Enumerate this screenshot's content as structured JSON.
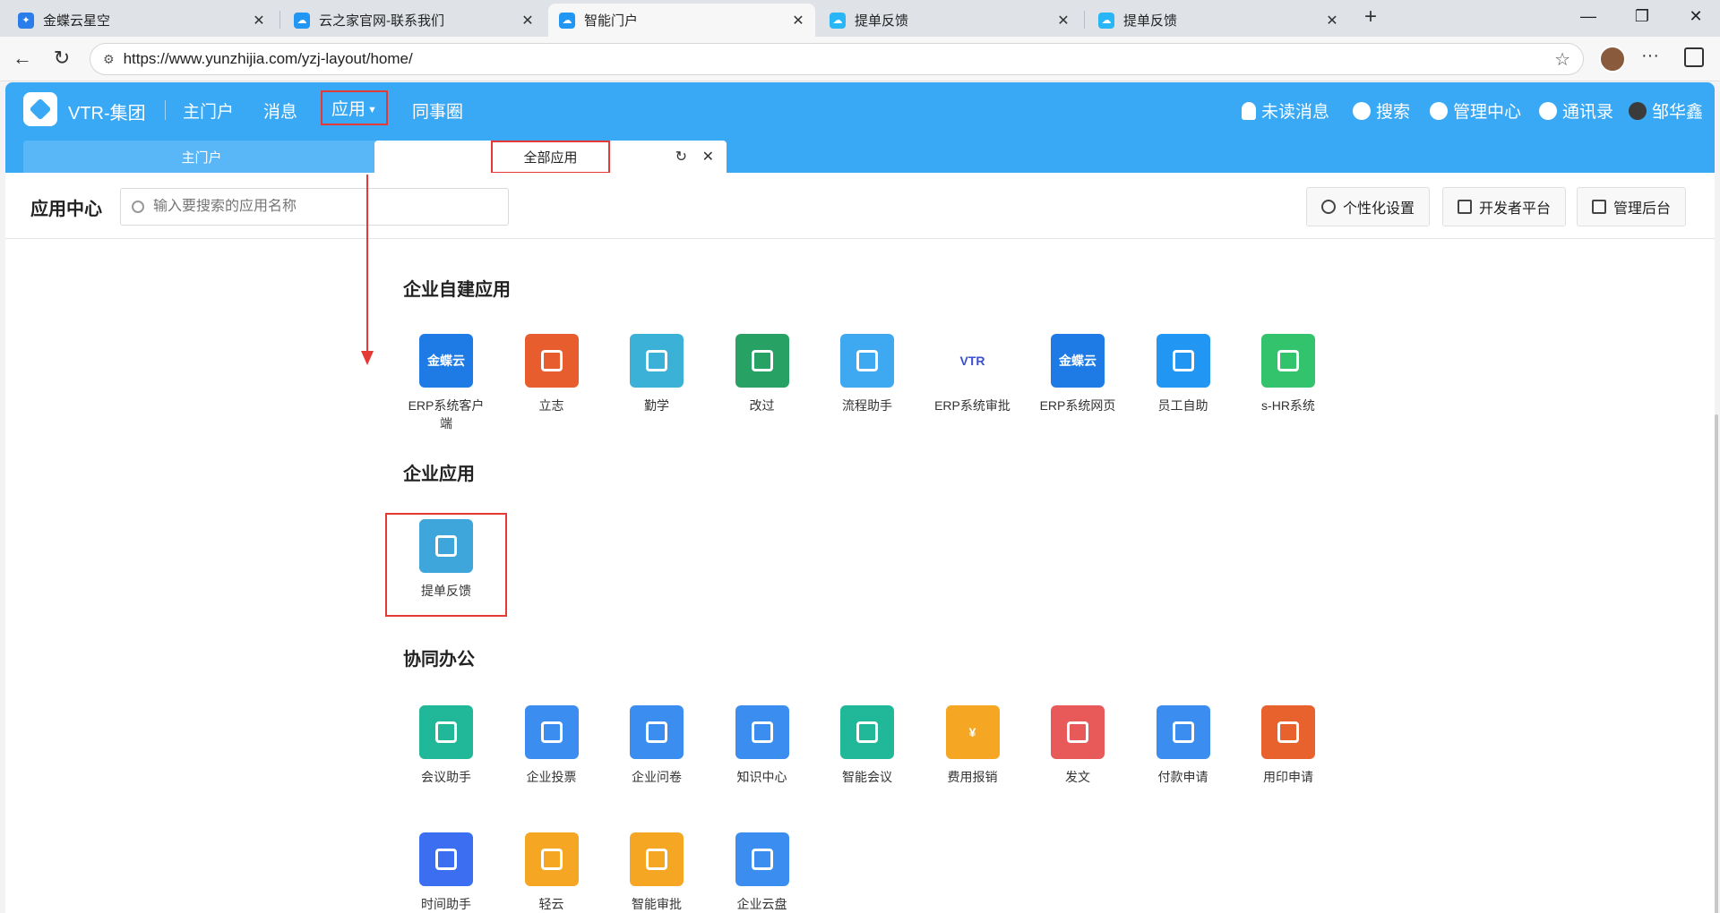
{
  "browser": {
    "tabs": [
      {
        "label": "金蝶云星空",
        "favicon": "kingdee-icon",
        "color": "#2b7de9"
      },
      {
        "label": "云之家官网-联系我们",
        "favicon": "cloud-icon",
        "color": "#2196f3"
      },
      {
        "label": "智能门户",
        "favicon": "cloud-icon",
        "color": "#2196f3"
      },
      {
        "label": "提单反馈",
        "favicon": "cloud-icon",
        "color": "#29b6f6"
      },
      {
        "label": "提单反馈",
        "favicon": "cloud-icon",
        "color": "#29b6f6"
      }
    ],
    "url": "https://www.yunzhijia.com/yzj-layout/home/"
  },
  "header": {
    "brand": "VTR-集团",
    "nav": {
      "home": "主门户",
      "messages": "消息",
      "apps": "应用",
      "colleagues": "同事圈"
    },
    "tools": {
      "unread": "未读消息",
      "search": "搜索",
      "admin": "管理中心",
      "contacts": "通讯录",
      "user": "邹华鑫"
    },
    "subtabs": {
      "home": "主门户",
      "all_apps": "全部应用"
    }
  },
  "toolbar": {
    "title": "应用中心",
    "search_placeholder": "输入要搜索的应用名称",
    "personalize": "个性化设置",
    "developer": "开发者平台",
    "admin_backend": "管理后台"
  },
  "sections": {
    "self_built": {
      "title": "企业自建应用",
      "apps": [
        {
          "label": "ERP系统客户端",
          "icon_text": "金蝶云",
          "color": "#1e7be6"
        },
        {
          "label": "立志",
          "icon_text": "",
          "color": "#e85d2e"
        },
        {
          "label": "勤学",
          "icon_text": "",
          "color": "#3bb1d8"
        },
        {
          "label": "改过",
          "icon_text": "",
          "color": "#27a164"
        },
        {
          "label": "流程助手",
          "icon_text": "",
          "color": "#3ea9f0"
        },
        {
          "label": "ERP系统审批",
          "icon_text": "VTR",
          "color": "#ffffff"
        },
        {
          "label": "ERP系统网页",
          "icon_text": "金蝶云",
          "color": "#1e7be6"
        },
        {
          "label": "员工自助",
          "icon_text": "",
          "color": "#2196f3"
        },
        {
          "label": "s-HR系统",
          "icon_text": "",
          "color": "#32c36c"
        }
      ]
    },
    "enterprise": {
      "title": "企业应用",
      "apps": [
        {
          "label": "提单反馈",
          "icon_text": "",
          "color": "#3fa6dc"
        }
      ]
    },
    "collab": {
      "title": "协同办公",
      "apps": [
        {
          "label": "会议助手",
          "icon_text": "",
          "color": "#21b89a"
        },
        {
          "label": "企业投票",
          "icon_text": "",
          "color": "#3b8ef0"
        },
        {
          "label": "企业问卷",
          "icon_text": "",
          "color": "#3b8ef0"
        },
        {
          "label": "知识中心",
          "icon_text": "",
          "color": "#3b8ef0"
        },
        {
          "label": "智能会议",
          "icon_text": "",
          "color": "#21b89a"
        },
        {
          "label": "费用报销",
          "icon_text": "¥",
          "color": "#f5a623"
        },
        {
          "label": "发文",
          "icon_text": "",
          "color": "#e85a5a"
        },
        {
          "label": "付款申请",
          "icon_text": "",
          "color": "#3b8ef0"
        },
        {
          "label": "用印申请",
          "icon_text": "",
          "color": "#e8622e"
        },
        {
          "label": "时间助手",
          "icon_text": "",
          "color": "#3b6ef0"
        },
        {
          "label": "轻云",
          "icon_text": "",
          "color": "#f5a623"
        },
        {
          "label": "智能审批",
          "icon_text": "",
          "color": "#f5a623"
        },
        {
          "label": "企业云盘",
          "icon_text": "",
          "color": "#3b8ef0"
        }
      ]
    }
  }
}
